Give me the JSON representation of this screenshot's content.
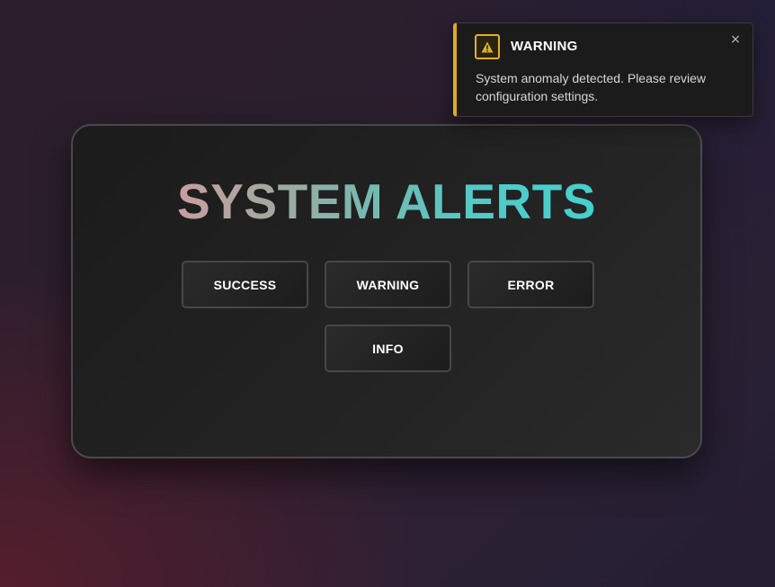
{
  "page": {
    "title": "SYSTEM ALERTS"
  },
  "buttons": {
    "success": "SUCCESS",
    "warning": "WARNING",
    "error": "ERROR",
    "info": "INFO"
  },
  "toast": {
    "type": "warning",
    "icon": "warning-triangle-icon",
    "title": "WARNING",
    "message": "System anomaly detected. Please review configuration settings.",
    "close_label": "×",
    "accent_color": "#e0aa1e"
  },
  "colors": {
    "title_gradient_start": "#c99ea0",
    "title_gradient_end": "#45d0d0",
    "panel_background": "#222222",
    "warning_accent": "#e0aa1e"
  }
}
